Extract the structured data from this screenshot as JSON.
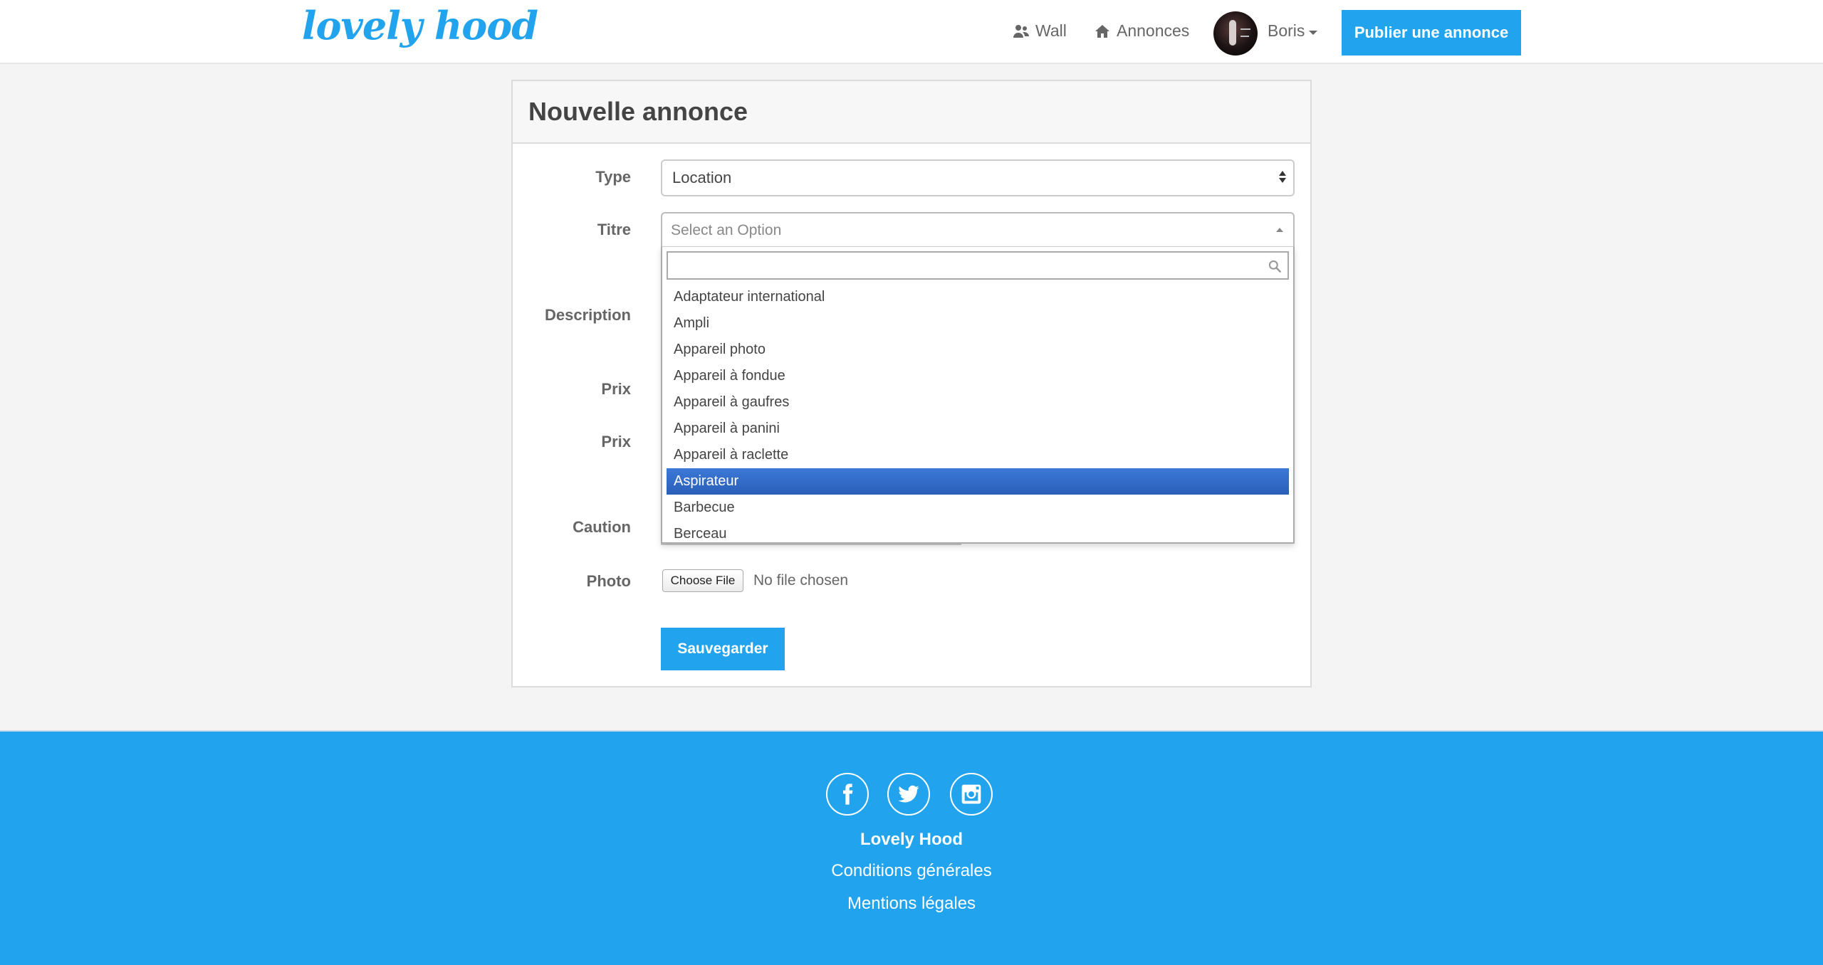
{
  "brand": {
    "logo_text": "lovely hood",
    "color": "#22a3ee"
  },
  "nav": {
    "wall_label": "Wall",
    "wall_icon": "users-icon",
    "annonces_label": "Annonces",
    "annonces_icon": "home-icon",
    "user_name": "Boris",
    "publish_label": "Publier une annonce"
  },
  "form": {
    "title": "Nouvelle annonce",
    "labels": {
      "type": "Type",
      "titre": "Titre",
      "description": "Description",
      "prix1": "Prix",
      "prix2": "Prix",
      "caution": "Caution",
      "photo": "Photo"
    },
    "type_value": "Location",
    "titre_placeholder": "Select an Option",
    "dropdown": {
      "search_value": "",
      "options": [
        "Adaptateur international",
        "Ampli",
        "Appareil photo",
        "Appareil à fondue",
        "Appareil à gaufres",
        "Appareil à panini",
        "Appareil à raclette",
        "Aspirateur",
        "Barbecue",
        "Berceau"
      ],
      "highlighted": "Aspirateur",
      "highlight_color": "#3875d7"
    },
    "file_button": "Choose File",
    "file_status": "No file chosen",
    "save_label": "Sauvegarder"
  },
  "footer": {
    "social": [
      "facebook-icon",
      "twitter-icon",
      "instagram-icon"
    ],
    "brand": "Lovely Hood",
    "links": [
      "Conditions générales",
      "Mentions légales"
    ]
  }
}
